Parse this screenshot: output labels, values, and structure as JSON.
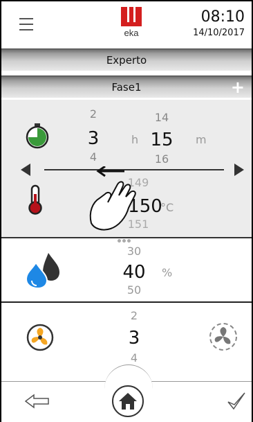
{
  "header": {
    "menu_icon": "hamburger-menu-icon",
    "brand": "eka",
    "time": "08:10",
    "date": "14/10/2017"
  },
  "mode_bar": {
    "label": "Experto"
  },
  "phase_bar": {
    "label": "Fase1",
    "add_label": "+"
  },
  "timer": {
    "icon": "timer-icon",
    "hours": {
      "prev": "2",
      "current": "3",
      "next": "4",
      "unit": "h"
    },
    "minutes": {
      "prev": "14",
      "current": "15",
      "next": "16",
      "unit": "m"
    }
  },
  "temperature": {
    "icon": "thermometer-icon",
    "prev": "149",
    "current": "150",
    "next": "151",
    "unit": "°C"
  },
  "humidity": {
    "icon": "water-drops-icon",
    "prev": "30",
    "current": "40",
    "next": "50",
    "unit": "%"
  },
  "fan": {
    "icon": "fan-icon",
    "secondary_icon": "fan-off-icon",
    "prev": "2",
    "current": "3",
    "next": "4"
  },
  "nav": {
    "back_icon": "back-arrow-icon",
    "home_icon": "home-icon",
    "confirm_icon": "checkmark-icon"
  },
  "colors": {
    "brand_red": "#d41f1f",
    "timer_green": "#3a9a3a",
    "thermometer_red": "#b5121b",
    "water_blue": "#1e88e5",
    "fan_orange": "#f5a623"
  }
}
